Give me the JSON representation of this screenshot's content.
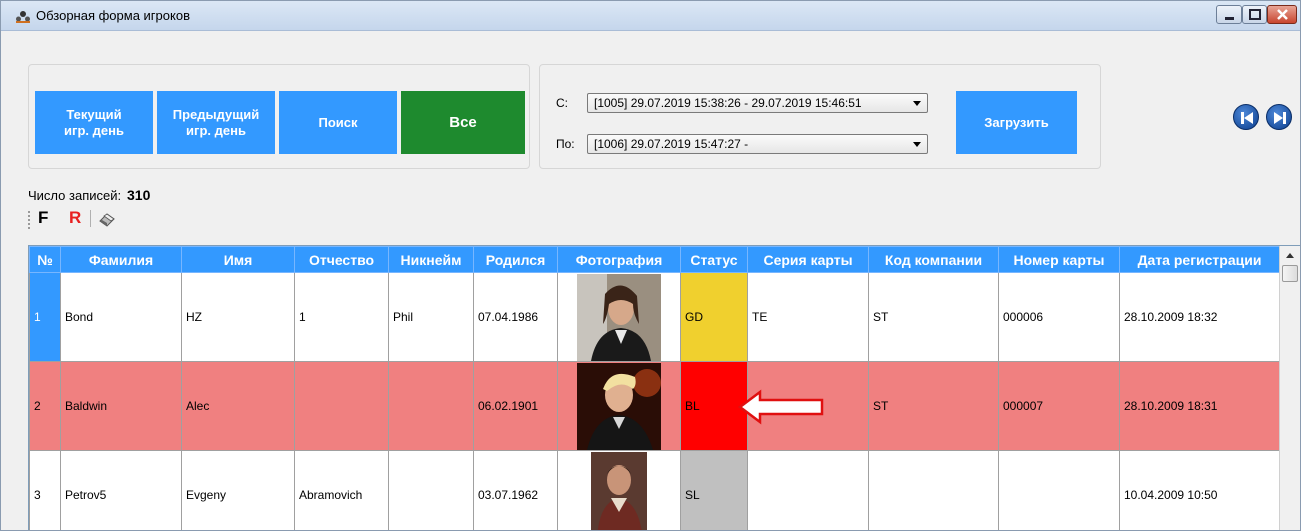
{
  "window": {
    "title": "Обзорная форма игроков"
  },
  "filters": {
    "current_day_label": "Текущий\nигр. день",
    "previous_day_label": "Предыдущий\nигр. день",
    "search_label": "Поиск",
    "all_label": "Все"
  },
  "period": {
    "from_label": "С:",
    "from_value": "[1005] 29.07.2019 15:38:26 - 29.07.2019 15:46:51",
    "to_label": "По:",
    "to_value": "[1006] 29.07.2019 15:47:27 -",
    "load_label": "Загрузить"
  },
  "records": {
    "label": "Число записей:",
    "count": "310"
  },
  "toolbar": {
    "f_label": "F",
    "r_label": "R"
  },
  "table": {
    "headers": [
      "№",
      "Фамилия",
      "Имя",
      "Отчество",
      "Никнейм",
      "Родился",
      "Фотография",
      "Статус",
      "Серия карты",
      "Код компании",
      "Номер карты",
      "Дата регистрации"
    ],
    "rows": [
      {
        "num": "1",
        "last_name": "Bond",
        "first_name": "HZ",
        "patronymic": "1",
        "nickname": "Phil",
        "born": "07.04.1986",
        "status": "GD",
        "card_series": "TE",
        "company_code": "ST",
        "card_number": "000006",
        "reg_date": "28.10.2009 18:32"
      },
      {
        "num": "2",
        "last_name": "Baldwin",
        "first_name": "Alec",
        "patronymic": "",
        "nickname": "",
        "born": "06.02.1901",
        "status": "BL",
        "card_series": "",
        "company_code": "ST",
        "card_number": "000007",
        "reg_date": "28.10.2009 18:31"
      },
      {
        "num": "3",
        "last_name": "Petrov5",
        "first_name": "Evgeny",
        "patronymic": "Abramovich",
        "nickname": "",
        "born": "03.07.1962",
        "status": "SL",
        "card_series": "",
        "company_code": "",
        "card_number": "",
        "reg_date": "10.04.2009 10:50"
      }
    ]
  },
  "colors": {
    "accent_blue": "#3399ff",
    "all_green": "#1e8a2e",
    "blocked_row": "#f08080",
    "status_gd": "#f0d02e",
    "status_bl": "#ff0000",
    "status_sl": "#c0c0c0"
  }
}
